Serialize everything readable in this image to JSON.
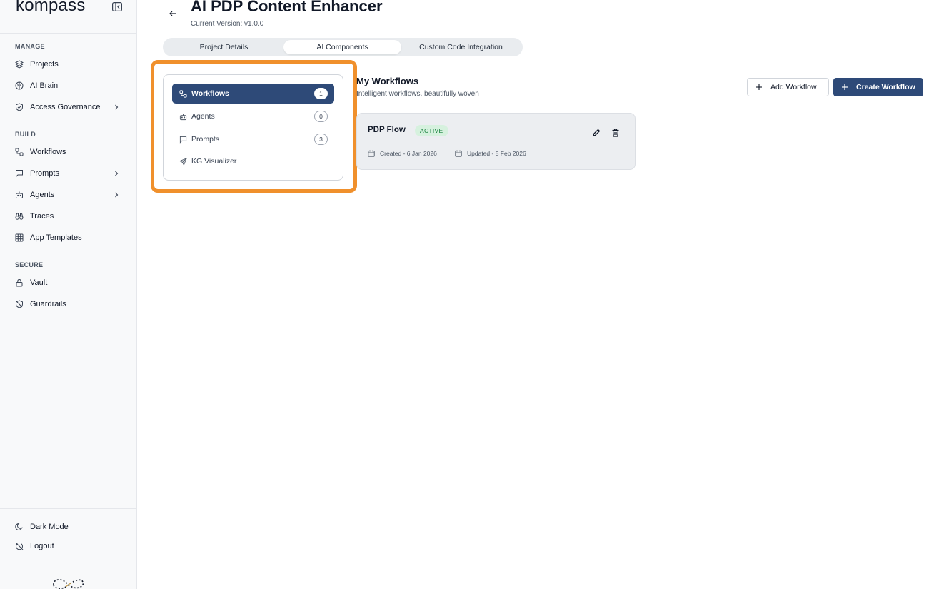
{
  "app": {
    "brand": "kompass"
  },
  "sidebar": {
    "sections": [
      {
        "label": "MANAGE"
      },
      {
        "label": "BUILD"
      },
      {
        "label": "SECURE"
      }
    ],
    "items": [
      {
        "label": "Projects",
        "icon": "layers-icon"
      },
      {
        "label": "AI Brain",
        "icon": "brain-icon"
      },
      {
        "label": "Access Governance",
        "icon": "shield-icon",
        "has_submenu": true
      },
      {
        "label": "Workflows",
        "icon": "workflow-icon"
      },
      {
        "label": "Prompts",
        "icon": "chat-icon",
        "has_submenu": true
      },
      {
        "label": "Agents",
        "icon": "bot-icon",
        "has_submenu": true
      },
      {
        "label": "Traces",
        "icon": "binoculars-icon"
      },
      {
        "label": "App Templates",
        "icon": "grid-icon"
      },
      {
        "label": "Vault",
        "icon": "lock-icon"
      },
      {
        "label": "Guardrails",
        "icon": "shield-off-icon"
      }
    ],
    "footer": [
      {
        "label": "Dark Mode",
        "icon": "moon-icon"
      },
      {
        "label": "Logout",
        "icon": "logout-icon"
      }
    ]
  },
  "header": {
    "title": "AI PDP Content Enhancer",
    "subtitle": "Current Version: v1.0.0"
  },
  "tabs": [
    {
      "label": "Project Details",
      "active": false
    },
    {
      "label": "AI Components",
      "active": true
    },
    {
      "label": "Custom Code Integration",
      "active": false
    }
  ],
  "component_nav": [
    {
      "label": "Workflows",
      "count": "1",
      "active": true,
      "icon": "workflow-icon"
    },
    {
      "label": "Agents",
      "count": "0",
      "active": false,
      "icon": "bot-icon"
    },
    {
      "label": "Prompts",
      "count": "3",
      "active": false,
      "icon": "chat-icon"
    },
    {
      "label": "KG Visualizer",
      "count": null,
      "active": false,
      "icon": "send-icon"
    }
  ],
  "workflows": {
    "title": "My Workflows",
    "subtitle": "Intelligent workflows, beautifully woven",
    "add_label": "Add Workflow",
    "create_label": "Create Workflow",
    "cards": [
      {
        "name": "PDP Flow",
        "status": "ACTIVE",
        "created": "Created - 6 Jan 2026",
        "updated": "Updated - 5 Feb 2026"
      }
    ]
  },
  "colors": {
    "primary": "#2e4a78",
    "highlight": "#f0902c",
    "status_bg": "#d6f1de",
    "status_text": "#16803c"
  }
}
